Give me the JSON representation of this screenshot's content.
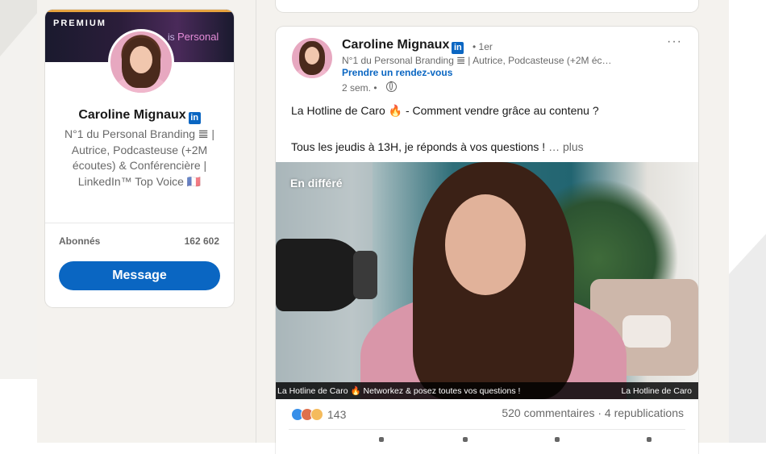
{
  "profile": {
    "banner_label": "PREMIUM",
    "banner_text_prefix": "is",
    "banner_text_highlight": "Personal",
    "name": "Caroline Mignaux",
    "linkedin_badge": "in",
    "headline": "N°1 du Personal Branding 𝌆 | Autrice, Podcasteuse (+2M écoutes) & Conférencière | LinkedIn™ Top Voice 🇫🇷",
    "followers_label": "Abonnés",
    "followers_value": "162 602",
    "message_button": "Message"
  },
  "post": {
    "author_name": "Caroline Mignaux",
    "linkedin_badge": "in",
    "degree": "• 1er",
    "author_headline": "N°1 du Personal Branding 𝌆 | Autrice, Podcasteuse (+2M éc…",
    "cta": "Prendre un rendez-vous",
    "time": "2 sem. •",
    "more_menu": "···",
    "text_line1": "La Hotline de Caro 🔥 - Comment vendre grâce au contenu ?",
    "text_line2": "Tous les jeudis à 13H, je réponds à vos questions !",
    "more_link": "… plus",
    "video": {
      "live_label": "En différé",
      "ticker_left": "La Hotline de Caro",
      "ticker_flame": "🔥",
      "ticker_middle": "Networkez & posez toutes vos questions !",
      "ticker_right": "La Hotline de Caro"
    },
    "reaction_count": "143",
    "comments_reposts": "520 commentaires · 4 republications"
  },
  "colors": {
    "linkedin_blue": "#0a66c2",
    "feed_background": "#f4f2ee",
    "premium_gold": "#e7a33e"
  }
}
